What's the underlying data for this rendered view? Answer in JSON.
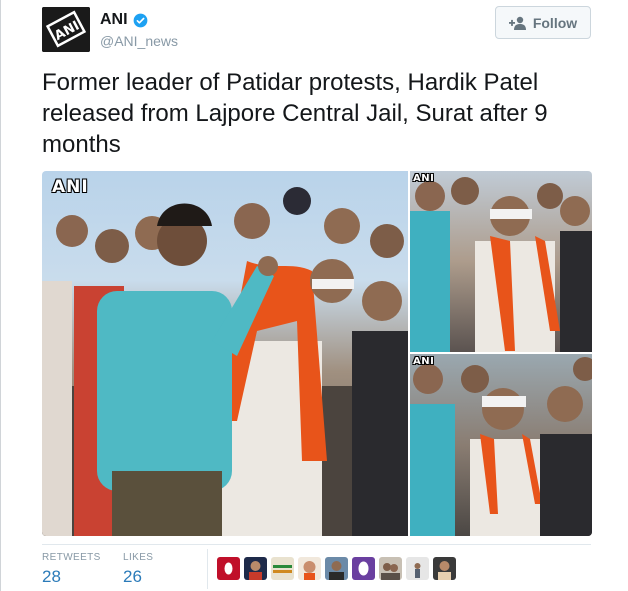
{
  "account": {
    "name": "ANI",
    "handle": "@ANI_news",
    "avatar_icon": "ani-logo-icon",
    "verified_icon": "verified-badge-icon"
  },
  "follow_button": {
    "label": "Follow",
    "icon": "add-user-icon"
  },
  "tweet": {
    "text": "Former leader of Patidar protests, Hardik Patel released from Lajpore Central Jail, Surat after 9 months"
  },
  "media": {
    "watermark": "ANI",
    "photos": [
      {
        "role": "main-photo"
      },
      {
        "role": "side-photo-top"
      },
      {
        "role": "side-photo-bottom"
      }
    ]
  },
  "stats": {
    "retweets_label": "RETWEETS",
    "retweets": "28",
    "likes_label": "LIKES",
    "likes": "26"
  },
  "likers_count": 9,
  "colors": {
    "link_blue": "#2b7bb9",
    "muted_gray": "#8899a6",
    "verified_blue": "#1da1f2",
    "saffron": "#e8541a"
  }
}
